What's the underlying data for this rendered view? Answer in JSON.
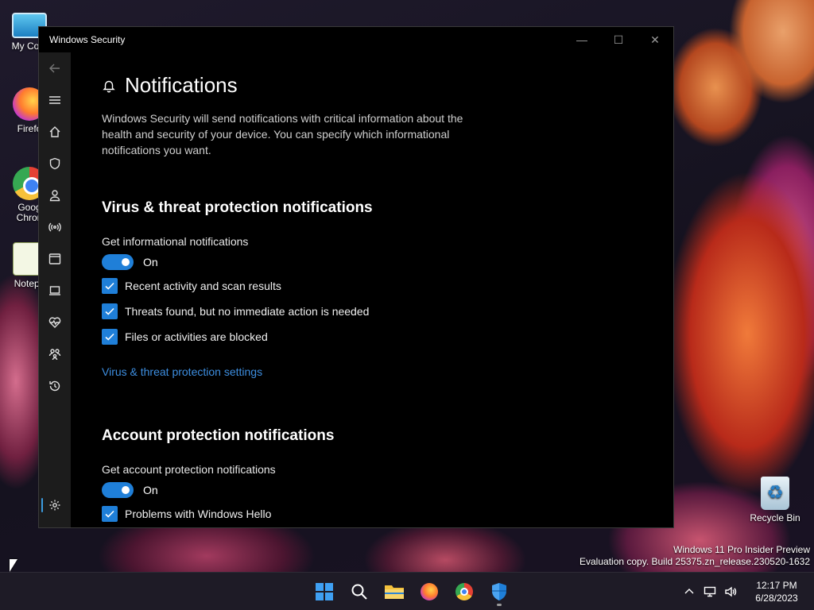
{
  "desktop": {
    "icons": [
      {
        "label": "My Com",
        "icon": "computer-icon"
      },
      {
        "label": "Firefo",
        "icon": "firefox-icon"
      },
      {
        "label": "Goog Chron",
        "icon": "chrome-icon"
      },
      {
        "label": "Notepa",
        "icon": "notepad-icon"
      },
      {
        "label": "Recycle Bin",
        "icon": "recycle-bin-icon"
      }
    ],
    "watermark_line1": "Windows 11 Pro Insider Preview",
    "watermark_line2": "Evaluation copy. Build 25375.zn_release.230520-1632"
  },
  "window": {
    "title": "Windows Security",
    "controls": {
      "minimize": "—",
      "maximize": "☐",
      "close": "✕"
    }
  },
  "sidebar": {
    "items": [
      {
        "name": "back",
        "icon": "back-arrow-icon"
      },
      {
        "name": "menu",
        "icon": "hamburger-icon"
      },
      {
        "name": "home",
        "icon": "home-icon"
      },
      {
        "name": "virus-protection",
        "icon": "shield-icon"
      },
      {
        "name": "account-protection",
        "icon": "person-icon"
      },
      {
        "name": "firewall",
        "icon": "network-antenna-icon"
      },
      {
        "name": "app-browser-control",
        "icon": "browser-window-icon"
      },
      {
        "name": "device-security",
        "icon": "laptop-icon"
      },
      {
        "name": "device-performance",
        "icon": "heart-pulse-icon"
      },
      {
        "name": "family-options",
        "icon": "family-icon"
      },
      {
        "name": "protection-history",
        "icon": "history-icon"
      },
      {
        "name": "settings",
        "icon": "gear-icon",
        "active": true
      }
    ]
  },
  "page": {
    "title": "Notifications",
    "description": "Windows Security will send notifications with critical information about the health and security of your device. You can specify which informational notifications you want.",
    "sections": [
      {
        "title": "Virus & threat protection notifications",
        "toggle_label": "Get informational notifications",
        "toggle_state": "On",
        "checkboxes": [
          "Recent activity and scan results",
          "Threats found, but no immediate action is needed",
          "Files or activities are blocked"
        ],
        "link": "Virus & threat protection settings"
      },
      {
        "title": "Account protection notifications",
        "toggle_label": "Get account protection notifications",
        "toggle_state": "On",
        "checkboxes": [
          "Problems with Windows Hello"
        ]
      }
    ]
  },
  "taskbar": {
    "apps": [
      "start-icon",
      "search-icon",
      "file-explorer-icon",
      "firefox-icon",
      "chrome-icon",
      "windows-security-icon"
    ],
    "time": "12:17 PM",
    "date": "6/28/2023"
  },
  "colors": {
    "accent": "#1f7fd8",
    "link": "#3d8ee0",
    "window_bg": "#000000",
    "sidebar_bg": "#1c1c1c"
  }
}
